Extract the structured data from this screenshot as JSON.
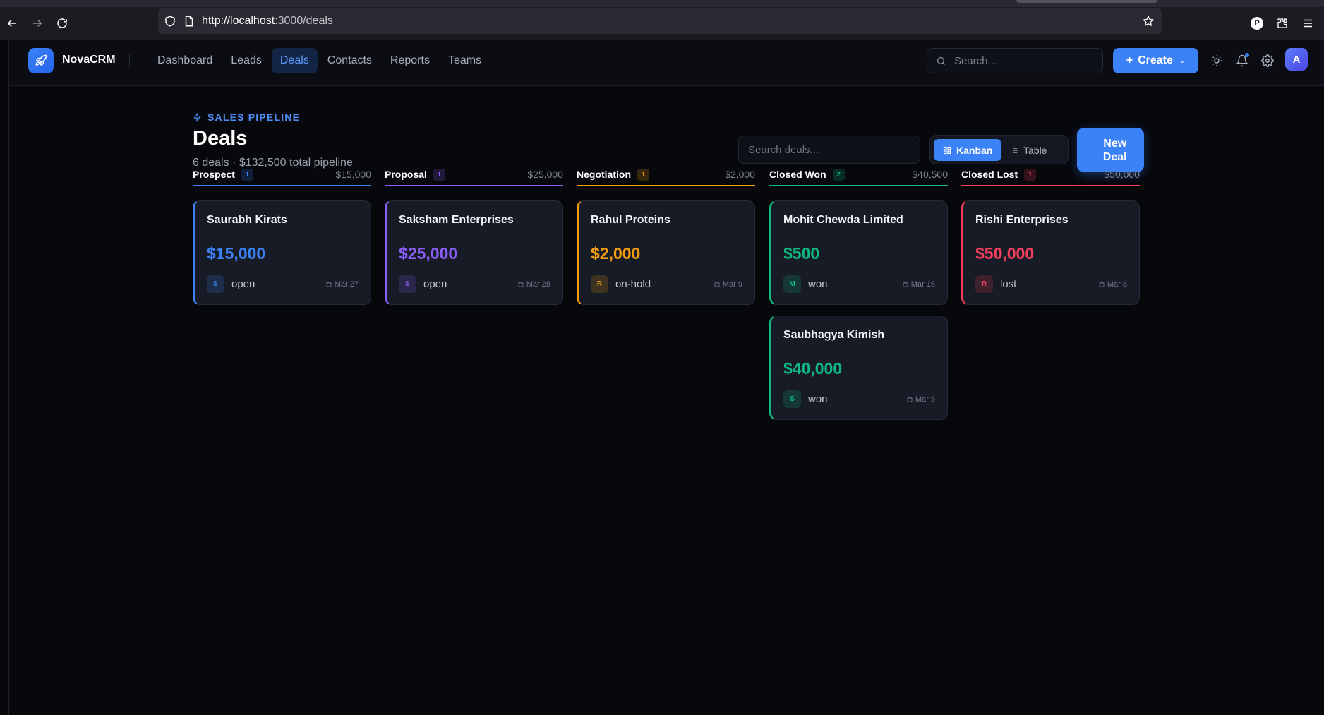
{
  "browser": {
    "url_host": "http://localhost",
    "url_rest": ":3000/deals"
  },
  "nav": {
    "brand": "NovaCRM",
    "items": [
      {
        "label": "Dashboard",
        "active": false
      },
      {
        "label": "Leads",
        "active": false
      },
      {
        "label": "Deals",
        "active": true
      },
      {
        "label": "Contacts",
        "active": false
      },
      {
        "label": "Reports",
        "active": false
      },
      {
        "label": "Teams",
        "active": false
      }
    ],
    "search_placeholder": "Search...",
    "create_label": "Create",
    "avatar_initial": "A"
  },
  "page": {
    "eyebrow": "SALES PIPELINE",
    "title": "Deals",
    "subtitle": "6 deals · $132,500 total pipeline",
    "search_placeholder": "Search deals...",
    "view_kanban": "Kanban",
    "view_table": "Table",
    "active_view": "Kanban",
    "new_deal_label": "New Deal"
  },
  "columns": [
    {
      "name": "Prospect",
      "count": "1",
      "total": "$15,000",
      "color": "#3b82f6",
      "deals": [
        {
          "title": "Saurabh Kirats",
          "amount": "$15,000",
          "initial": "S",
          "status": "open",
          "date": "Mar 27"
        }
      ]
    },
    {
      "name": "Proposal",
      "count": "1",
      "total": "$25,000",
      "color": "#8b5cf6",
      "deals": [
        {
          "title": "Saksham Enterprises",
          "amount": "$25,000",
          "initial": "S",
          "status": "open",
          "date": "Mar 28"
        }
      ]
    },
    {
      "name": "Negotiation",
      "count": "1",
      "total": "$2,000",
      "color": "#f59e0b",
      "deals": [
        {
          "title": "Rahul Proteins",
          "amount": "$2,000",
          "initial": "R",
          "status": "on-hold",
          "date": "Mar 9"
        }
      ]
    },
    {
      "name": "Closed Won",
      "count": "2",
      "total": "$40,500",
      "color": "#10b981",
      "deals": [
        {
          "title": "Mohit Chewda Limited",
          "amount": "$500",
          "initial": "M",
          "status": "won",
          "date": "Mar 16"
        },
        {
          "title": "Saubhagya Kimish",
          "amount": "$40,000",
          "initial": "S",
          "status": "won",
          "date": "Mar 5"
        }
      ]
    },
    {
      "name": "Closed Lost",
      "count": "1",
      "total": "$50,000",
      "color": "#f43f5e",
      "deals": [
        {
          "title": "Rishi Enterprises",
          "amount": "$50,000",
          "initial": "R",
          "status": "lost",
          "date": "Mar 8"
        }
      ]
    }
  ]
}
